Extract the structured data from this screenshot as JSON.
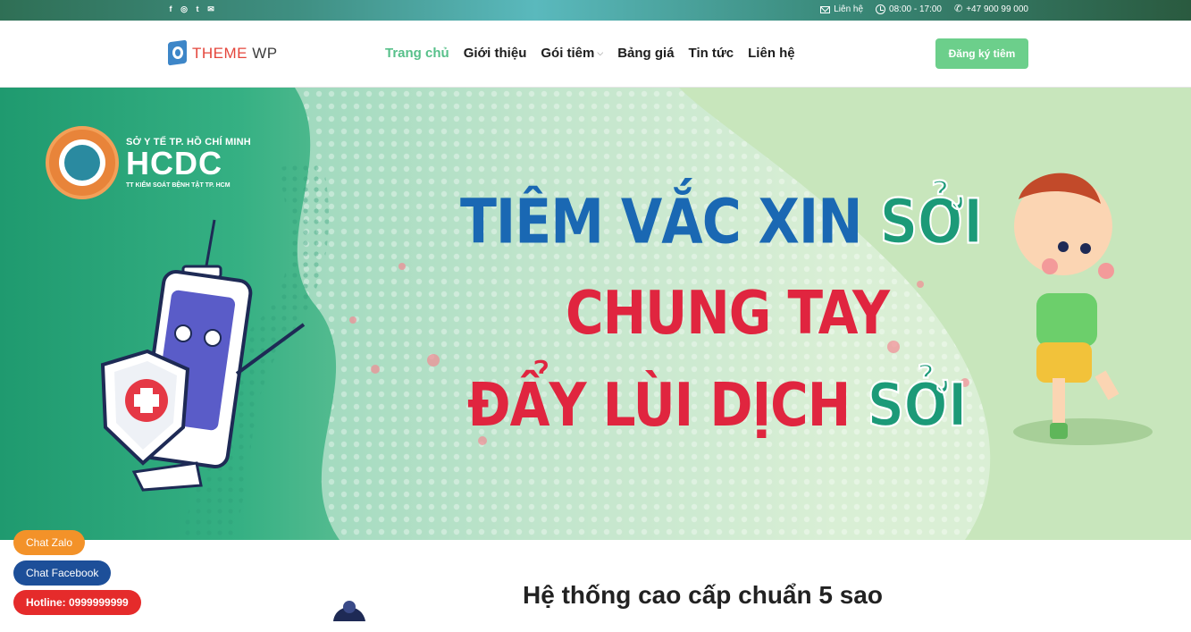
{
  "topbar": {
    "social": [
      "f",
      "◎",
      "t",
      "✉"
    ],
    "contact_label": "Liên hệ",
    "hours": "08:00 - 17:00",
    "phone": "+47 900 99 000"
  },
  "header": {
    "logo_part1": "THEME",
    "logo_part2": "WP",
    "nav": {
      "home": "Trang chủ",
      "about": "Giới thiệu",
      "packages": "Gói tiêm",
      "pricing": "Bảng giá",
      "news": "Tin tức",
      "contact": "Liên hệ"
    },
    "cta": "Đăng ký tiêm"
  },
  "banner": {
    "org_line1": "SỞ Y TẾ TP. HỒ CHÍ MINH",
    "org_name": "HCDC",
    "org_line3": "TT KIỂM SOÁT BỆNH TẬT TP. HCM",
    "line1_a": "TIÊM VẮC XIN ",
    "line1_b": "SỞI",
    "line2": "CHUNG TAY",
    "line3_a": "ĐẨY LÙI DỊCH ",
    "line3_b": "SỞI"
  },
  "floating": {
    "zalo": "Chat Zalo",
    "facebook": "Chat Facebook",
    "hotline": "Hotline: 0999999999"
  },
  "section": {
    "title": "Hệ thống cao cấp chuẩn 5 sao"
  },
  "colors": {
    "accent_green": "#57c08a",
    "cta_green": "#6ccf8b",
    "headline_blue": "#1a68b3",
    "headline_red": "#e0253f",
    "headline_green": "#1c9a78",
    "zalo_orange": "#f39229",
    "facebook_blue": "#1d4f99",
    "hotline_red": "#e52b2b"
  }
}
